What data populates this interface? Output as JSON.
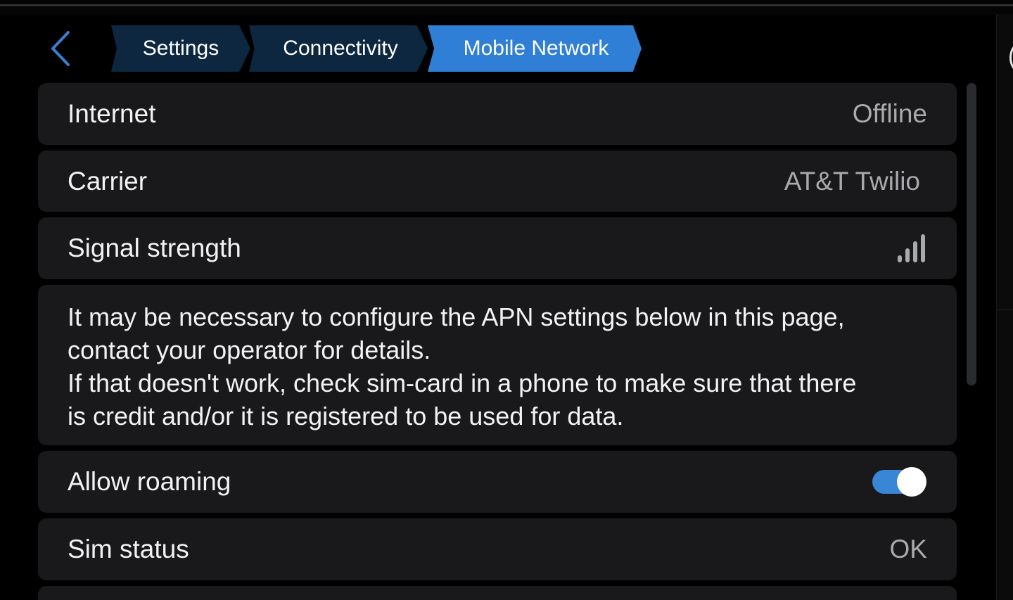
{
  "header": {
    "back_icon": "chevron-left-icon",
    "breadcrumb": [
      "Settings",
      "Connectivity",
      "Mobile Network"
    ]
  },
  "rows": {
    "internet": {
      "label": "Internet",
      "value": "Offline"
    },
    "carrier": {
      "label": "Carrier",
      "value": "AT&T Twilio"
    },
    "signal": {
      "label": "Signal strength",
      "icon": "signal-bars-icon",
      "bars_lit": 4,
      "bars_total": 4
    },
    "note": {
      "lines": [
        "It may be necessary to configure the APN settings below in this page,",
        "contact your operator for details.",
        "If that doesn't work, check sim-card in a phone to make sure that there",
        "is credit and/or it is registered to be used for data."
      ]
    },
    "roaming": {
      "label": "Allow roaming",
      "enabled": true
    },
    "sim": {
      "label": "Sim status",
      "value": "OK"
    }
  },
  "colors": {
    "accent": "#2f7fd6",
    "crumb_inactive": "#0d2740",
    "row_bg": "#19191b",
    "value_text": "#a9aaad"
  }
}
